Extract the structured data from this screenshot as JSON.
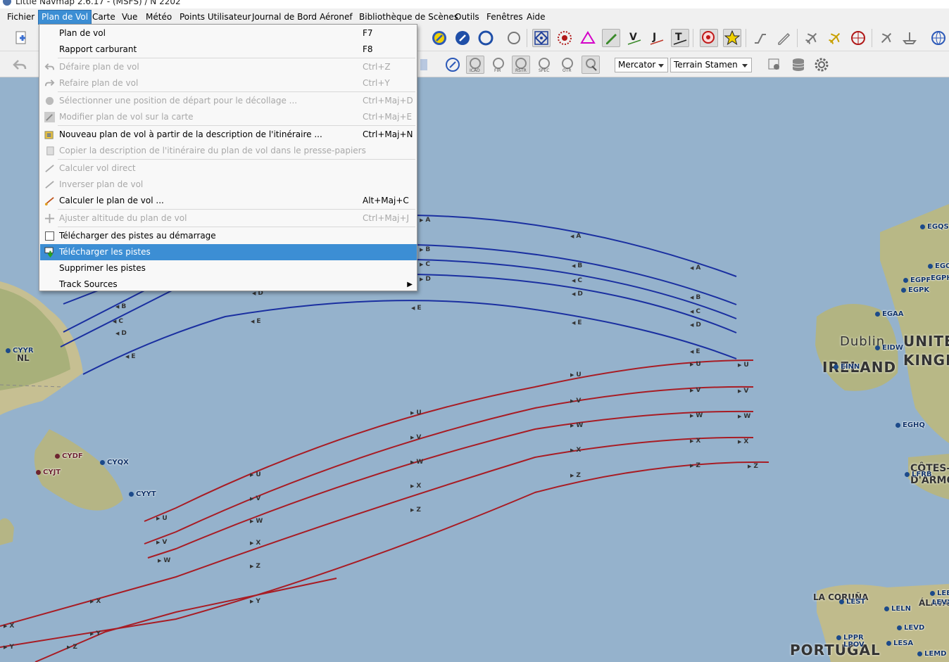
{
  "window": {
    "title": "Little Navmap 2.6.17 - (MSFS) / N 2202"
  },
  "menubar": [
    {
      "label": "Fichier",
      "active": false
    },
    {
      "label": "Plan de Vol",
      "active": true
    },
    {
      "label": "Carte",
      "active": false
    },
    {
      "label": "Vue",
      "active": false
    },
    {
      "label": "Météo",
      "active": false
    },
    {
      "label": "Points Utilisateur",
      "active": false
    },
    {
      "label": "Journal de Bord",
      "active": false
    },
    {
      "label": "Aéronef",
      "active": false
    },
    {
      "label": "Bibliothèque de Scènes",
      "active": false
    },
    {
      "label": "Outils",
      "active": false
    },
    {
      "label": "Fenêtres",
      "active": false
    },
    {
      "label": "Aide",
      "active": false
    }
  ],
  "flightplan_menu": [
    {
      "label": "Plan de vol",
      "shortcut": "F7",
      "enabled": true,
      "icon": "none"
    },
    {
      "label": "Rapport carburant",
      "shortcut": "F8",
      "enabled": true,
      "icon": "none"
    },
    {
      "label": "Défaire plan de vol",
      "shortcut": "Ctrl+Z",
      "enabled": false,
      "icon": "undo-icon"
    },
    {
      "label": "Refaire plan de vol",
      "shortcut": "Ctrl+Y",
      "enabled": false,
      "icon": "redo-icon"
    },
    {
      "label": "Sélectionner une position de départ pour le décollage ...",
      "shortcut": "Ctrl+Maj+D",
      "enabled": false,
      "icon": "departure-position-icon"
    },
    {
      "label": "Modifier plan de vol sur la carte",
      "shortcut": "Ctrl+Maj+E",
      "enabled": false,
      "icon": "edit-map-icon"
    },
    {
      "label": "Nouveau plan de vol à partir de la description de l'itinéraire ...",
      "shortcut": "Ctrl+Maj+N",
      "enabled": true,
      "icon": "route-description-icon"
    },
    {
      "label": "Copier la description de l'itinéraire du plan de vol dans le presse-papiers",
      "shortcut": "",
      "enabled": false,
      "icon": "copy-route-icon"
    },
    {
      "label": "Calculer vol direct",
      "shortcut": "",
      "enabled": false,
      "icon": "direct-route-icon"
    },
    {
      "label": "Inverser plan de vol",
      "shortcut": "",
      "enabled": false,
      "icon": "reverse-route-icon"
    },
    {
      "label": "Calculer le plan de vol ...",
      "shortcut": "Alt+Maj+C",
      "enabled": true,
      "icon": "calculate-route-icon"
    },
    {
      "label": "Ajuster altitude du plan de vol",
      "shortcut": "Ctrl+Maj+J",
      "enabled": false,
      "icon": "adjust-altitude-icon"
    },
    {
      "label": "Télécharger des pistes au démarrage",
      "shortcut": "",
      "enabled": true,
      "icon": "checkbox",
      "checked": false
    },
    {
      "label": "Télécharger les pistes",
      "shortcut": "",
      "enabled": true,
      "icon": "download-tracks-icon",
      "highlighted": true
    },
    {
      "label": "Supprimer les pistes",
      "shortcut": "",
      "enabled": true,
      "icon": "none"
    },
    {
      "label": "Track Sources",
      "shortcut": "",
      "enabled": true,
      "icon": "none",
      "submenu": true
    }
  ],
  "map_controls": {
    "projection": "Mercator",
    "theme": "Terrain Stamen"
  },
  "map": {
    "airports": [
      {
        "code": "EGQS",
        "closed": false
      },
      {
        "code": "EGQK",
        "closed": false
      },
      {
        "code": "EGPF",
        "closed": false
      },
      {
        "code": "EGPH",
        "closed": false
      },
      {
        "code": "EGPK",
        "closed": false
      },
      {
        "code": "EGAA",
        "closed": false
      },
      {
        "code": "EIDW",
        "closed": false
      },
      {
        "code": "EINN",
        "closed": false
      },
      {
        "code": "EGHQ",
        "closed": false
      },
      {
        "code": "LFRB",
        "closed": false
      },
      {
        "code": "CYYR",
        "closed": false
      },
      {
        "code": "CYDF",
        "closed": true
      },
      {
        "code": "CYQX",
        "closed": false
      },
      {
        "code": "CYJT",
        "closed": true
      },
      {
        "code": "CYYT",
        "closed": false
      },
      {
        "code": "LEST",
        "closed": false
      },
      {
        "code": "LELN",
        "closed": false
      },
      {
        "code": "LEVD",
        "closed": false
      },
      {
        "code": "LPPR",
        "closed": false
      },
      {
        "code": "LPOV",
        "closed": false
      },
      {
        "code": "LESA",
        "closed": false
      },
      {
        "code": "LEMD",
        "closed": false
      },
      {
        "code": "LEBB",
        "closed": false
      },
      {
        "code": "LEVX",
        "closed": false
      }
    ],
    "places": {
      "dublin": "Dublin",
      "ireland": "IRELAND",
      "uk": "UNITED KINGDOM",
      "nl": "NL",
      "cotes": "CÔTES-D'ARMOR",
      "lacoruna": "LA CORUÑA",
      "alava": "ÁLAVA",
      "portugal": "PORTUGAL"
    },
    "tracks_westbound": [
      "A",
      "B",
      "C",
      "D",
      "E"
    ],
    "tracks_eastbound": [
      "U",
      "V",
      "W",
      "X",
      "Y",
      "Z"
    ],
    "colors": {
      "westbound": "#1a2fa0",
      "eastbound": "#a81c24",
      "highlight": "#3c8ed4"
    }
  }
}
